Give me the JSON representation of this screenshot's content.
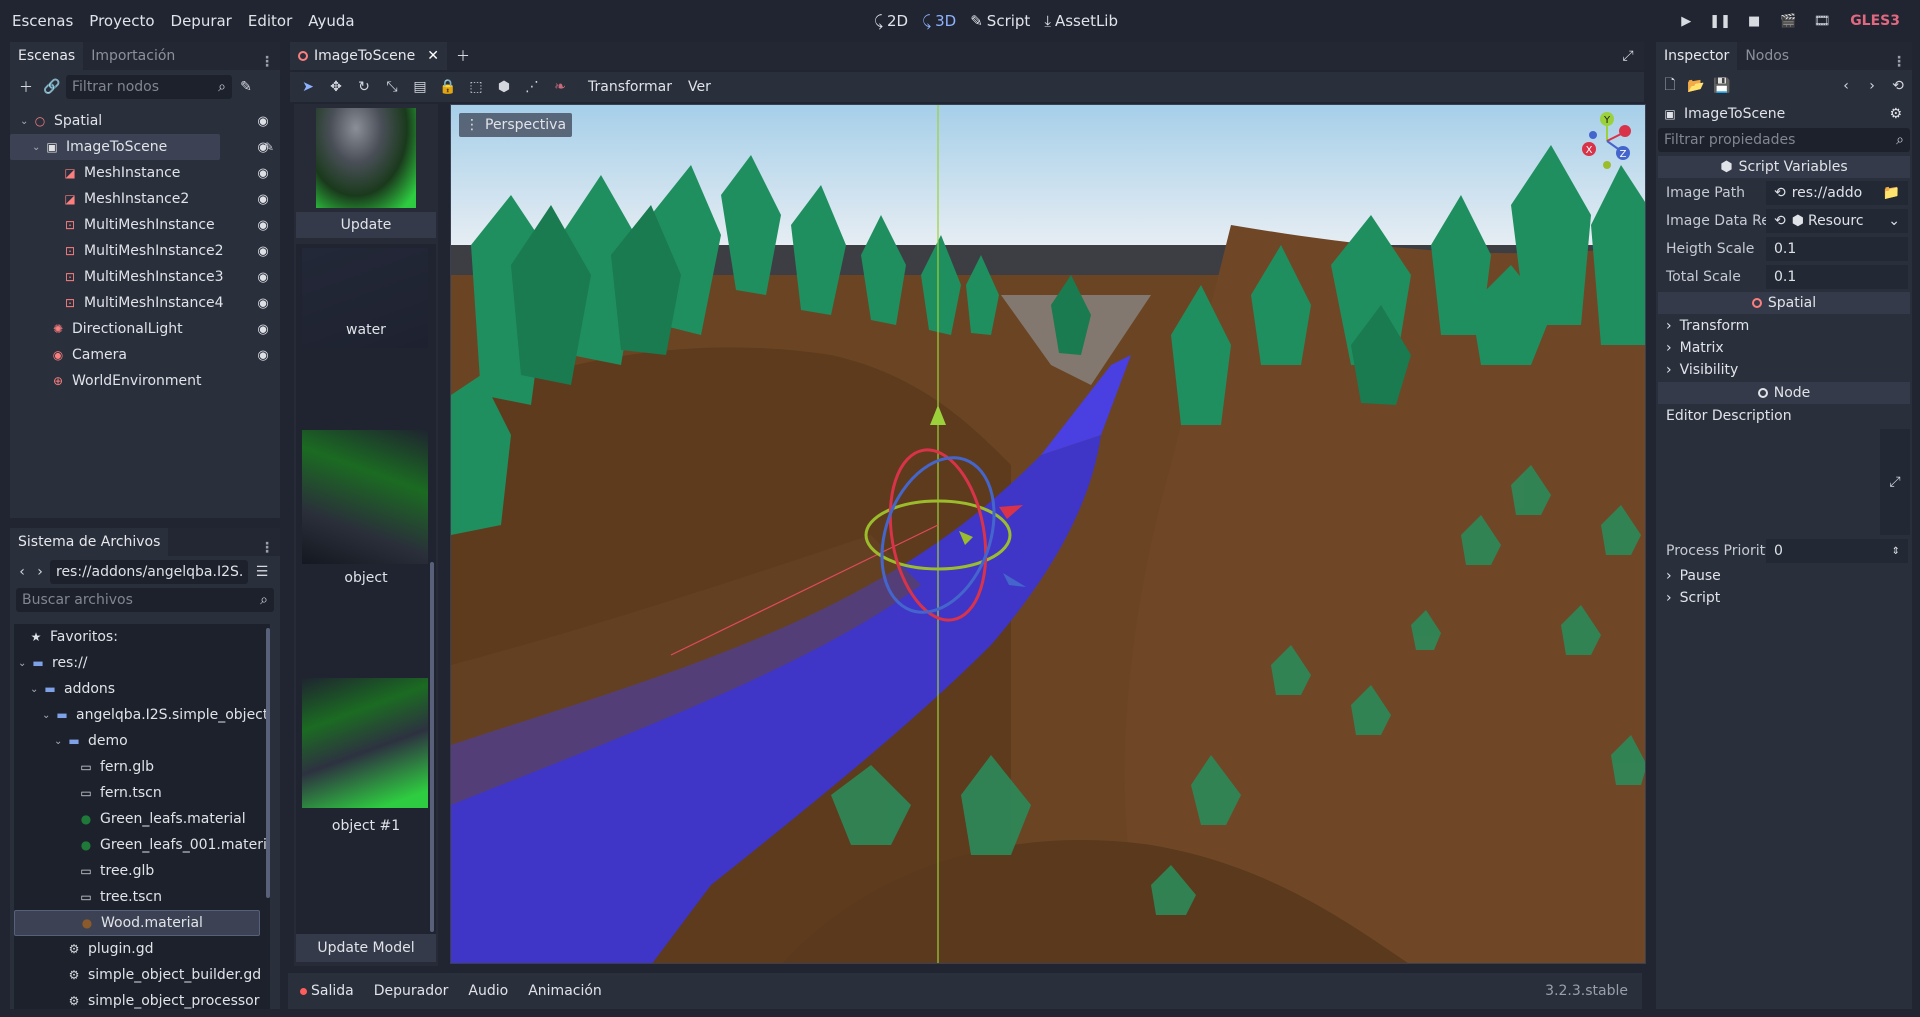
{
  "menu": [
    "Escenas",
    "Proyecto",
    "Depurar",
    "Editor",
    "Ayuda"
  ],
  "workspaces": [
    {
      "label": "2D",
      "icon": "2d-icon",
      "active": false
    },
    {
      "label": "3D",
      "icon": "3d-icon",
      "active": true
    },
    {
      "label": "Script",
      "icon": "script-icon",
      "active": false
    },
    {
      "label": "AssetLib",
      "icon": "assetlib-icon",
      "active": false
    }
  ],
  "renderer": "GLES3",
  "scene_dock": {
    "tabs": [
      "Escenas",
      "Importación"
    ],
    "filter_placeholder": "Filtrar nodos",
    "nodes": [
      {
        "label": "Spatial",
        "icon": "spatial-icon",
        "color": "#fc7f7f"
      },
      {
        "label": "ImageToScene",
        "icon": "script-node-icon",
        "color": "#e0e0e0"
      },
      {
        "label": "MeshInstance",
        "icon": "mesh-instance-icon",
        "color": "#fc7f7f"
      },
      {
        "label": "MeshInstance2",
        "icon": "mesh-instance-icon",
        "color": "#fc7f7f"
      },
      {
        "label": "MultiMeshInstance",
        "icon": "multimesh-instance-icon",
        "color": "#fc7f7f"
      },
      {
        "label": "MultiMeshInstance2",
        "icon": "multimesh-instance-icon",
        "color": "#fc7f7f"
      },
      {
        "label": "MultiMeshInstance3",
        "icon": "multimesh-instance-icon",
        "color": "#fc7f7f"
      },
      {
        "label": "MultiMeshInstance4",
        "icon": "multimesh-instance-icon",
        "color": "#fc7f7f"
      },
      {
        "label": "DirectionalLight",
        "icon": "directional-light-icon",
        "color": "#fc7f7f"
      },
      {
        "label": "Camera",
        "icon": "camera-icon",
        "color": "#fc7f7f"
      },
      {
        "label": "WorldEnvironment",
        "icon": "world-environment-icon",
        "color": "#fc7f7f"
      }
    ]
  },
  "filesystem": {
    "tab": "Sistema de Archivos",
    "path": "res://addons/angelqba.I2S.",
    "search_placeholder": "Buscar archivos",
    "favorites": "Favoritos:",
    "items": [
      {
        "label": "res://",
        "icon": "folder-icon"
      },
      {
        "label": "addons",
        "icon": "folder-icon"
      },
      {
        "label": "angelqba.I2S.simple_object",
        "icon": "folder-icon"
      },
      {
        "label": "demo",
        "icon": "folder-icon"
      },
      {
        "label": "fern.glb",
        "icon": "scene-file-icon"
      },
      {
        "label": "fern.tscn",
        "icon": "scene-file-icon"
      },
      {
        "label": "Green_leafs.material",
        "icon": "material-icon"
      },
      {
        "label": "Green_leafs_001.materi",
        "icon": "material-icon"
      },
      {
        "label": "tree.glb",
        "icon": "scene-file-icon"
      },
      {
        "label": "tree.tscn",
        "icon": "scene-file-icon"
      },
      {
        "label": "Wood.material",
        "icon": "material-icon"
      },
      {
        "label": "plugin.gd",
        "icon": "gear-icon"
      },
      {
        "label": "simple_object_builder.gd",
        "icon": "gear-icon"
      },
      {
        "label": "simple_object_processor",
        "icon": "gear-icon"
      }
    ]
  },
  "editor_tab": "ImageToScene",
  "toolbar": {
    "transform": "Transformar",
    "view": "Ver"
  },
  "side_panel": {
    "update": "Update",
    "labels": [
      "water",
      "object",
      "object #1"
    ],
    "update_model": "Update Model"
  },
  "viewport": {
    "perspective": "Perspectiva"
  },
  "inspector": {
    "tabs": [
      "Inspector",
      "Nodos"
    ],
    "node": "ImageToScene",
    "filter_placeholder": "Filtrar propiedades",
    "script_variables": "Script Variables",
    "props": [
      {
        "label": "Image Path",
        "value": "res://addo"
      },
      {
        "label": "Image Data Re",
        "value": "Resourc"
      },
      {
        "label": "Heigth Scale",
        "value": "0.1"
      },
      {
        "label": "Total Scale",
        "value": "0.1"
      }
    ],
    "spatial": "Spatial",
    "spatial_subs": [
      "Transform",
      "Matrix",
      "Visibility"
    ],
    "node_section": "Node",
    "editor_description": "Editor Description",
    "process_priority_label": "Process Priority",
    "process_priority": "0",
    "node_subs": [
      "Pause",
      "Script"
    ]
  },
  "bottom": {
    "tabs": [
      "Salida",
      "Depurador",
      "Audio",
      "Animación"
    ],
    "version": "3.2.3.stable"
  }
}
